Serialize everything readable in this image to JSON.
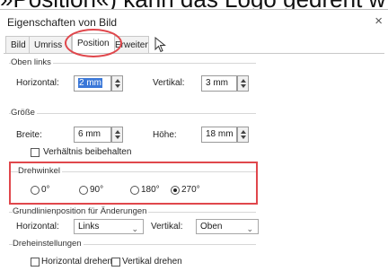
{
  "background_text": "»Position«) kann das Logo gedreht w",
  "window": {
    "title": "Eigenschaften von Bild",
    "close_glyph": "×"
  },
  "tabs": [
    "Bild",
    "Umriss",
    "Position",
    "Erweitert"
  ],
  "active_tab": "Position",
  "oben_links": {
    "group_label": "Oben links",
    "horizontal_label": "Horizontal:",
    "horizontal_value": "2 mm",
    "vertikal_label": "Vertikal:",
    "vertikal_value": "3 mm"
  },
  "groesse": {
    "group_label": "Größe",
    "breite_label": "Breite:",
    "breite_value": "6 mm",
    "hoehe_label": "Höhe:",
    "hoehe_value": "18 mm",
    "keep_ratio_label": "Verhältnis beibehalten"
  },
  "drehwinkel": {
    "group_label": "Drehwinkel",
    "options": [
      "0°",
      "90°",
      "180°",
      "270°"
    ],
    "selected": "270°"
  },
  "grundlinie": {
    "group_label": "Grundlinienposition für Änderungen",
    "horizontal_label": "Horizontal:",
    "horizontal_value": "Links",
    "vertikal_label": "Vertikal:",
    "vertikal_value": "Oben"
  },
  "dreheinstellungen": {
    "group_label": "Dreheinstellungen",
    "horizontal_flip_label": "Horizontal drehen",
    "vertical_flip_label": "Vertikal drehen"
  },
  "colors": {
    "highlight": "#e0474c",
    "selection": "#3b78d8"
  }
}
